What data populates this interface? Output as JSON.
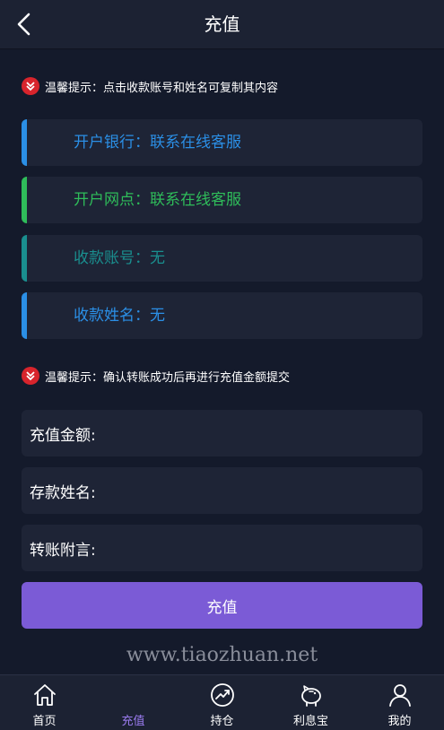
{
  "header": {
    "title": "充值"
  },
  "notice_top": {
    "text": "温馨提示：点击收款账号和姓名可复制其内容"
  },
  "info_cards": [
    {
      "text": "开户银行：联系在线客服",
      "color": "#2b8fe6"
    },
    {
      "text": "开户网点：联系在线客服",
      "color": "#2fbd5a"
    },
    {
      "text": "收款账号：无",
      "color": "#1a8f8f"
    },
    {
      "text": "收款姓名：无",
      "color": "#2b8fe6"
    }
  ],
  "notice_bottom": {
    "text": "温馨提示：确认转账成功后再进行充值金额提交"
  },
  "form": {
    "amount_label": "充值金额:",
    "name_label": "存款姓名:",
    "note_label": "转账附言:"
  },
  "submit": {
    "label": "充值",
    "color": "#7b5bd6"
  },
  "watermark": "www.tiaozhuan.net",
  "tabbar": {
    "tabs": [
      {
        "label": "首页",
        "icon": "home-icon"
      },
      {
        "label": "充值",
        "icon": "recharge-icon",
        "active": true
      },
      {
        "label": "持仓",
        "icon": "trend-icon"
      },
      {
        "label": "利息宝",
        "icon": "piggy-bank-icon"
      },
      {
        "label": "我的",
        "icon": "user-icon"
      }
    ]
  }
}
